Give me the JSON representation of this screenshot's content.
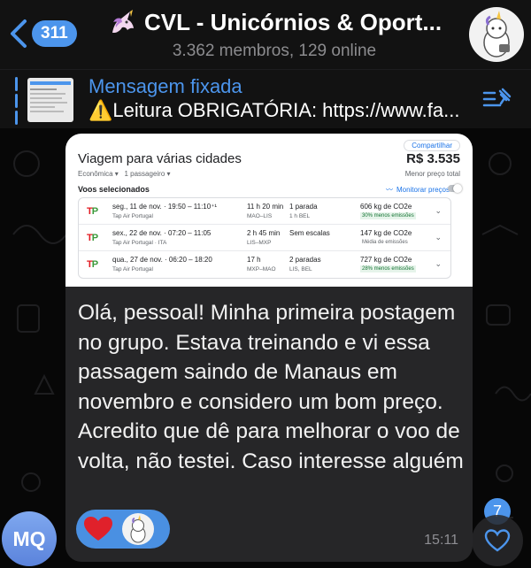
{
  "header": {
    "back_count": "311",
    "title": "CVL - Unicórnios & Oport...",
    "subtitle": "3.362 membros, 129 online"
  },
  "pinned": {
    "title": "Mensagem fixada",
    "text": "Leitura OBRIGATÓRIA: https://www.fa..."
  },
  "flight_shot": {
    "share_label": "Compartilhar",
    "title": "Viagem para várias cidades",
    "price": "R$ 3.535",
    "meta_class": "Econômica",
    "meta_passengers": "1 passageiro",
    "lowest_label": "Menor preço total",
    "selected_label": "Voos selecionados",
    "monitor_label": "Monitorar preços",
    "flights": [
      {
        "time": "seg., 11 de nov. · 19:50 – 11:10⁺¹",
        "airline": "Tap Air Portugal",
        "duration": "11 h 20 min",
        "route": "MAO–LIS",
        "stops": "1 parada",
        "stop_detail": "1 h BEL",
        "co2": "606 kg de CO2e",
        "co2_note": "30% menos emissões"
      },
      {
        "time": "sex., 22 de nov. · 07:20 – 11:05",
        "airline": "Tap Air Portugal · ITA",
        "duration": "2 h 45 min",
        "route": "LIS–MXP",
        "stops": "Sem escalas",
        "stop_detail": "",
        "co2": "147 kg de CO2e",
        "co2_note": "Média de emissões"
      },
      {
        "time": "qua., 27 de nov. · 06:20 – 18:20",
        "airline": "Tap Air Portugal",
        "duration": "17 h",
        "route": "MXP–MAO",
        "stops": "2 paradas",
        "stop_detail": "LIS, BEL",
        "co2": "727 kg de CO2e",
        "co2_note": "28% menos emissões"
      }
    ]
  },
  "message": {
    "text": "Olá, pessoal! Minha primeira postagem no grupo. Estava treinando e vi essa passagem saindo de Manaus em novembro e considero um bom preço. Acredito que dê para melhorar o voo de volta, não testei. Caso interesse alguém",
    "time": "15:11"
  },
  "sender": {
    "initials": "MQ"
  },
  "unread_badge": "7",
  "colors": {
    "accent": "#4c95ec",
    "bubble": "#262628",
    "background": "#070707"
  },
  "icons": [
    "back-chevron-icon",
    "unicorn-icon",
    "pin-list-icon",
    "heart-icon",
    "like-heart-icon",
    "warning-icon"
  ]
}
